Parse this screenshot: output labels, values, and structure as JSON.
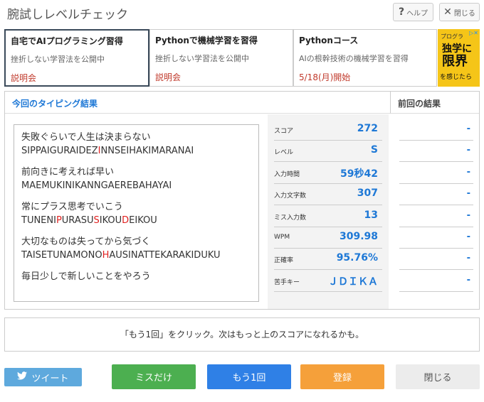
{
  "header": {
    "title": "腕試しレベルチェック",
    "help_icon": "?",
    "help_label": "ヘルプ",
    "close_icon": "✕",
    "close_label": "閉じる"
  },
  "ads": [
    {
      "title": "自宅でAIプログラミング習得",
      "sub": "挫折しない学習法を公開中",
      "link": "説明会"
    },
    {
      "title": "Pythonで機械学習を習得",
      "sub": "挫折しない学習法を公開中",
      "link": "説明会"
    },
    {
      "title": "Pythonコース",
      "sub": "AIの根幹技術の機械学習を習得",
      "link": "5/18(月)開始"
    }
  ],
  "banner": {
    "line1": "プログラ",
    "line2a": "独学に",
    "line2b": "限界",
    "line3": "を感じたら",
    "ad_mark": "▷✕"
  },
  "results": {
    "current_title": "今回のタイピング結果",
    "previous_title": "前回の結果",
    "words": [
      {
        "jp": "失敗ぐらいで人生は決まらない",
        "ro": [
          {
            "t": "SIPPAIGURAIDEZ",
            "m": false
          },
          {
            "t": "I",
            "m": true
          },
          {
            "t": "NNSEIHAKIMARANAI",
            "m": false
          }
        ]
      },
      {
        "jp": "前向きに考えれば早い",
        "ro": [
          {
            "t": "MAEMUKINIKANNGAEREBAHAYAI",
            "m": false
          }
        ]
      },
      {
        "jp": "常にプラス思考でいこう",
        "ro": [
          {
            "t": "TUNENI",
            "m": false
          },
          {
            "t": "P",
            "m": true
          },
          {
            "t": "URASU",
            "m": false
          },
          {
            "t": "S",
            "m": true
          },
          {
            "t": "IKOU",
            "m": false
          },
          {
            "t": "D",
            "m": true
          },
          {
            "t": "EIKOU",
            "m": false
          }
        ]
      },
      {
        "jp": "大切なものは失ってから気づく",
        "ro": [
          {
            "t": "TAISETUNAMONO",
            "m": false
          },
          {
            "t": "H",
            "m": true
          },
          {
            "t": "AUSINATTEKARAKIDUKU",
            "m": false
          }
        ]
      },
      {
        "jp": "毎日少しで新しいことをやろう",
        "ro": []
      }
    ],
    "stats": [
      {
        "label": "スコア",
        "value": "272",
        "prev": "-"
      },
      {
        "label": "レベル",
        "value": "S",
        "prev": "-"
      },
      {
        "label": "入力時間",
        "value": "59秒42",
        "prev": "-"
      },
      {
        "label": "入力文字数",
        "value": "307",
        "prev": "-"
      },
      {
        "label": "ミス入力数",
        "value": "13",
        "prev": "-"
      },
      {
        "label": "WPM",
        "value": "309.98",
        "prev": "-"
      },
      {
        "label": "正確率",
        "value": "95.76%",
        "prev": "-"
      },
      {
        "label": "苦手キー",
        "value": "ＪＤＩＫＡ",
        "prev": "-"
      }
    ]
  },
  "message": "「もう1回」をクリック。次はもっと上のスコアになれるかも。",
  "buttons": {
    "tweet": "ツイート",
    "miss_only": "ミスだけ",
    "again": "もう1回",
    "register": "登録",
    "close": "閉じる"
  }
}
